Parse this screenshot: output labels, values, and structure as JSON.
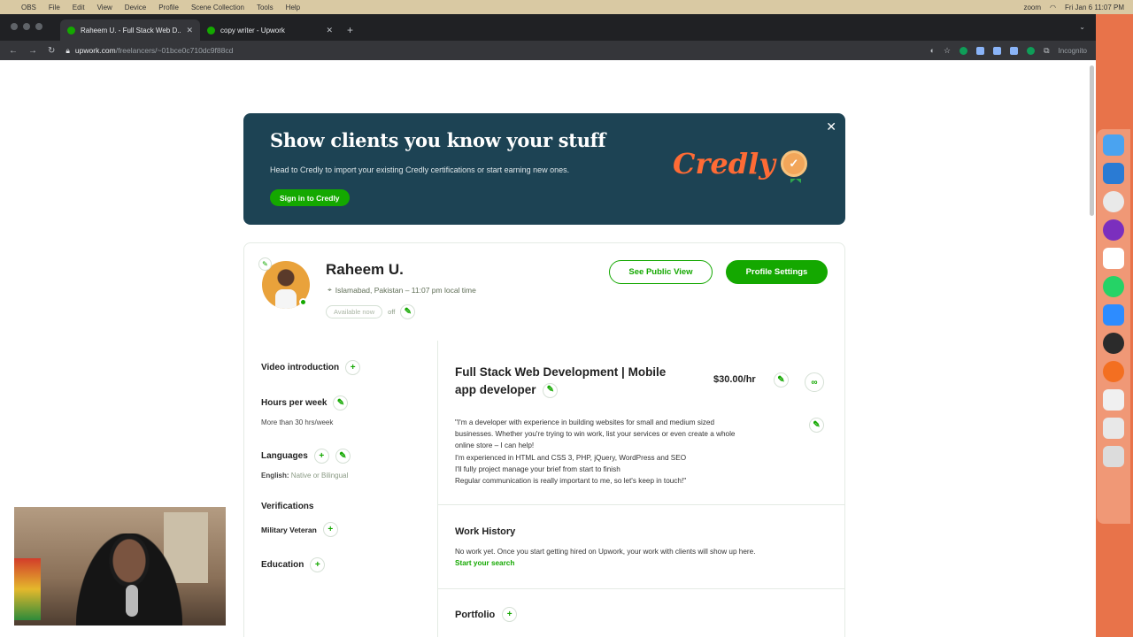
{
  "menubar": {
    "items": [
      "OBS",
      "File",
      "Edit",
      "View",
      "Device",
      "Profile",
      "Scene Collection",
      "Tools",
      "Help"
    ],
    "right_items": [
      "zoom",
      "Fri Jan 6  11:07 PM"
    ]
  },
  "browser": {
    "tabs": [
      {
        "title": "Raheem U. - Full Stack Web D..."
      },
      {
        "title": "copy writer - Upwork"
      }
    ],
    "new_tab": "+",
    "url_domain": "upwork.com",
    "url_path": "/freelancers/~01bce0c710dc9f88cd",
    "incognito_label": "Incognito"
  },
  "banner": {
    "title": "Show clients you know your stuff",
    "subtitle": "Head to Credly to import your existing Credly certifications or start earning new ones.",
    "button": "Sign in to Credly",
    "brand": "Credly",
    "close": "✕"
  },
  "profile": {
    "name": "Raheem U.",
    "location": "Islamabad, Pakistan – 11:07 pm local time",
    "availability_pill": "Available now",
    "availability_state": "off",
    "see_public_view": "See Public View",
    "profile_settings": "Profile Settings",
    "sidebar": {
      "video_intro": "Video introduction",
      "hours_title": "Hours per week",
      "hours_value": "More than 30 hrs/week",
      "languages_title": "Languages",
      "language_name": "English:",
      "language_level": "Native or Bilingual",
      "verifications_title": "Verifications",
      "military": "Military Veteran",
      "education_title": "Education"
    },
    "headline_line1": "Full Stack Web Development | Mobile",
    "headline_line2": "app developer",
    "rate": "$30.00/hr",
    "description": [
      "\"I'm a developer with experience in building websites for small and medium sized",
      "businesses. Whether you're trying to win work, list your services or even create a whole",
      "online store – I can help!",
      "I'm experienced in HTML and CSS 3, PHP, jQuery, WordPress and SEO",
      "I'll fully project manage your brief from start to finish",
      "Regular communication is really important to me, so let's keep in touch!\""
    ],
    "work_history_title": "Work History",
    "work_history_text": "No work yet. Once you start getting hired on Upwork, your work with clients will show up here.",
    "work_history_link": "Start your search",
    "portfolio_title": "Portfolio"
  },
  "colors": {
    "upwork_green": "#14a800",
    "banner_bg": "#1d4354",
    "credly_orange": "#ff6b35"
  }
}
